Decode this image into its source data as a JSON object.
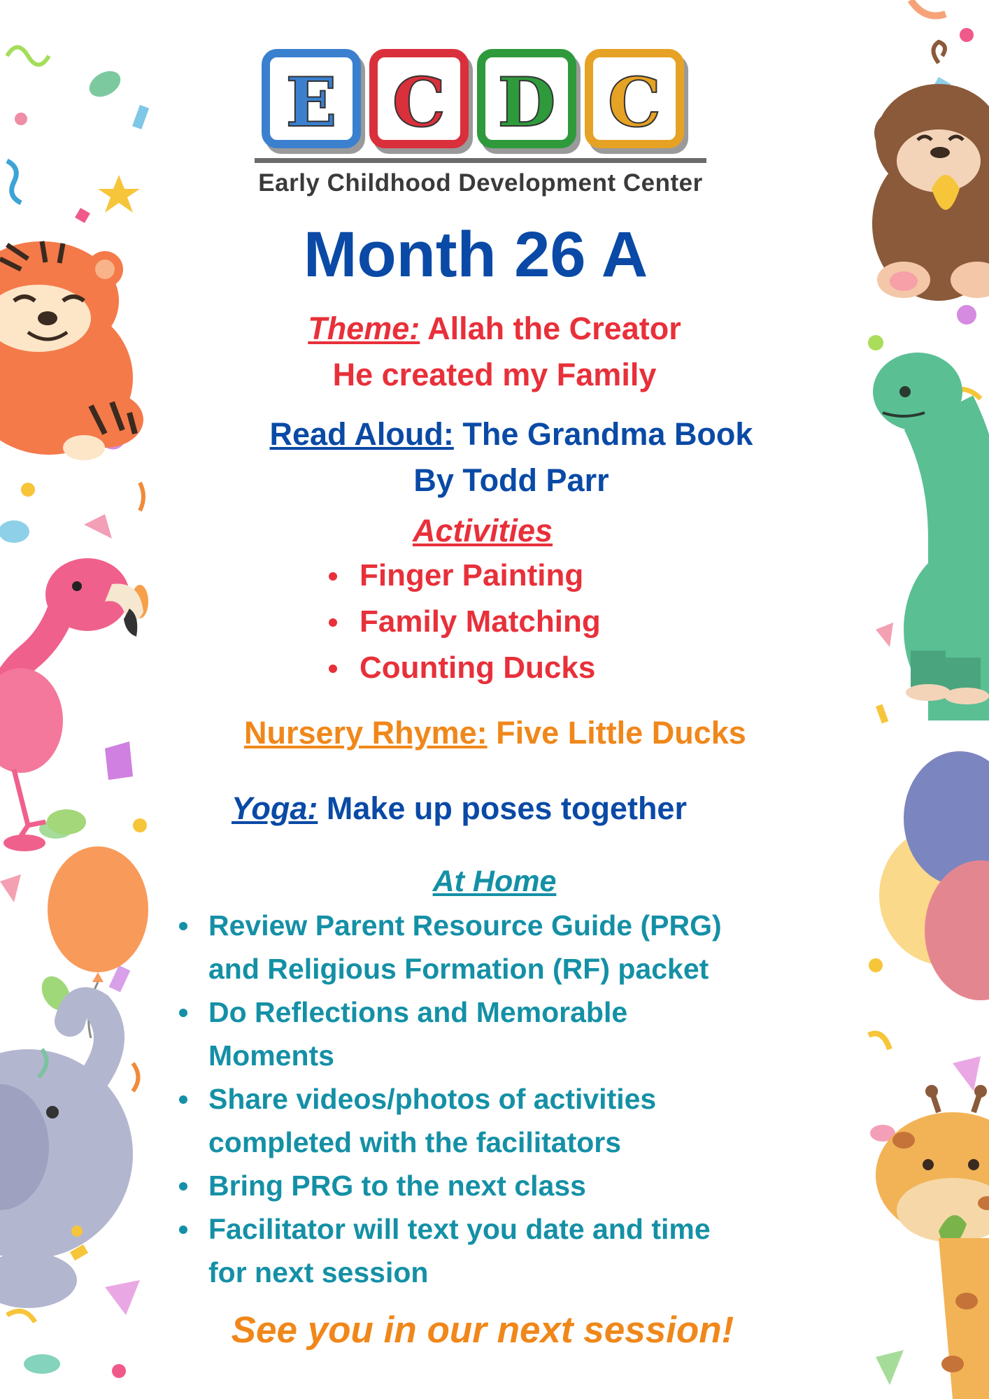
{
  "logo": {
    "letters": [
      "E",
      "C",
      "D",
      "C"
    ],
    "subtitle": "Early Childhood Development Center",
    "colors": [
      "#3b80cf",
      "#d9303c",
      "#2f9a3c",
      "#e6a224"
    ]
  },
  "title": "Month 26 A",
  "theme": {
    "label": "Theme:",
    "line1": "Allah the Creator",
    "line2": "He created my Family"
  },
  "read_aloud": {
    "label": "Read Aloud:",
    "book": "The Grandma Book",
    "author": "By Todd Parr"
  },
  "activities": {
    "heading": "Activities",
    "items": [
      "Finger Painting",
      "Family Matching",
      "Counting Ducks"
    ]
  },
  "nursery_rhyme": {
    "label": "Nursery Rhyme:",
    "value": "Five Little Ducks"
  },
  "yoga": {
    "label": "Yoga:",
    "value": "Make up poses together"
  },
  "at_home": {
    "heading": "At Home",
    "items": [
      [
        "Review Parent Resource Guide (PRG)",
        "and Religious Formation (RF) packet"
      ],
      [
        "Do Reflections and Memorable",
        "Moments"
      ],
      [
        "Share videos/photos of activities",
        "completed with the facilitators"
      ],
      [
        "Bring PRG to the next class"
      ],
      [
        "Facilitator will text you date and time",
        "for next session"
      ]
    ]
  },
  "closing": "See you in our next session!",
  "colors": {
    "title_blue": "#0a4aa6",
    "red": "#e8303a",
    "orange": "#f0871a",
    "teal": "#1490a6"
  },
  "decorations": {
    "left": [
      "tiger",
      "flamingo",
      "balloon",
      "elephant",
      "confetti"
    ],
    "right": [
      "monkey",
      "dinosaur",
      "balloons",
      "giraffe",
      "confetti"
    ]
  }
}
